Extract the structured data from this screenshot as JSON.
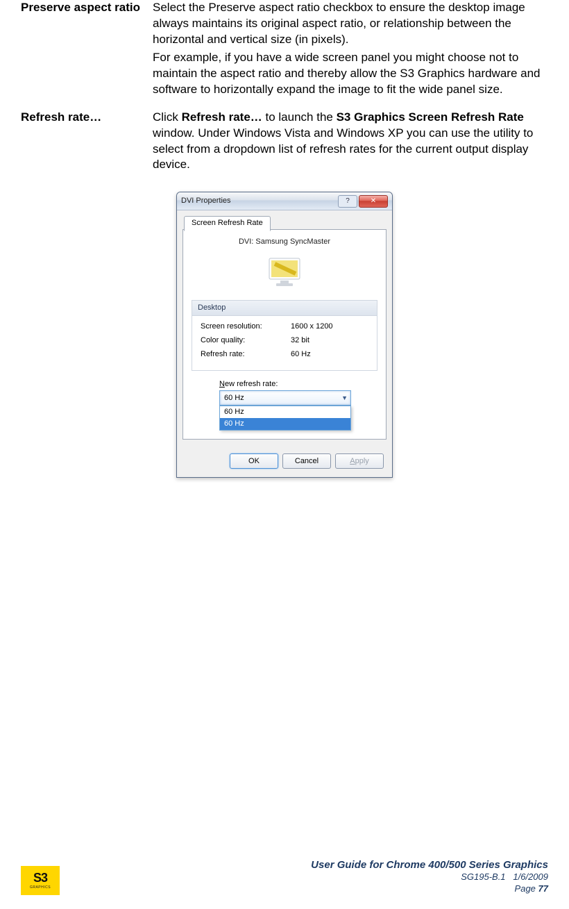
{
  "definitions": [
    {
      "term": "Preserve aspect ratio",
      "desc": [
        "Select the Preserve aspect ratio checkbox to ensure the desktop image always maintains its original aspect ratio, or relationship between the horizontal and vertical size (in pixels).",
        "For example, if you have a wide screen panel you might choose not to maintain the aspect ratio and thereby allow the S3 Graphics hardware and software to horizontally expand the image to fit the wide panel size."
      ]
    },
    {
      "term": "Refresh rate…",
      "desc_html": {
        "prefix": "Click ",
        "bold1": "Refresh rate…",
        "mid": " to launch the ",
        "bold2": "S3 Graphics Screen Refresh Rate",
        "suffix": " window. Under Windows Vista and Windows XP you can use the utility to select from a dropdown list of refresh rates for the current output display device."
      }
    }
  ],
  "dialog": {
    "title": "DVI Properties",
    "tab": "Screen Refresh Rate",
    "monitor_label": "DVI: Samsung SyncMaster",
    "group_header": "Desktop",
    "rows": [
      {
        "k": "Screen resolution:",
        "v": "1600 x 1200"
      },
      {
        "k": "Color quality:",
        "v": "32 bit"
      },
      {
        "k": "Refresh rate:",
        "v": "60 Hz"
      }
    ],
    "refresh_label_pre": "N",
    "refresh_label_post": "ew refresh rate:",
    "combo_selected": "60 Hz",
    "combo_options": [
      "60 Hz",
      "60 Hz"
    ],
    "buttons": {
      "ok": "OK",
      "cancel": "Cancel",
      "apply": "Apply"
    }
  },
  "footer": {
    "title": "User Guide for Chrome 400/500 Series Graphics",
    "doc_id": "SG195-B.1",
    "date": "1/6/2009",
    "page_prefix": "Page ",
    "page_num": "77",
    "logo_text": "S3",
    "logo_sub": "GRAPHICS"
  }
}
